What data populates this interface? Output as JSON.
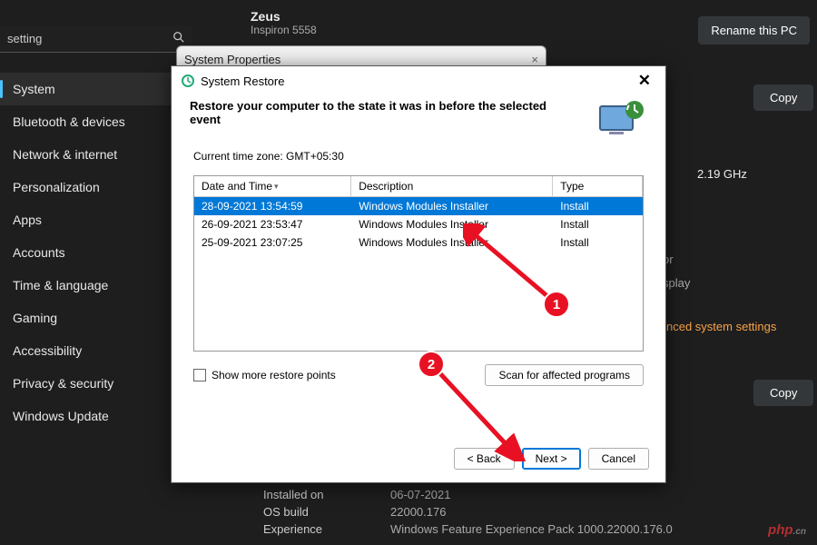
{
  "search": {
    "value": "setting",
    "icon_name": "search-icon"
  },
  "user": {
    "name": "Zeus",
    "model": "Inspiron 5558"
  },
  "rename_label": "Rename this PC",
  "sidebar": {
    "items": [
      {
        "label": "System",
        "active": true
      },
      {
        "label": "Bluetooth & devices"
      },
      {
        "label": "Network & internet"
      },
      {
        "label": "Personalization"
      },
      {
        "label": "Apps"
      },
      {
        "label": "Accounts"
      },
      {
        "label": "Time & language"
      },
      {
        "label": "Gaming"
      },
      {
        "label": "Accessibility"
      },
      {
        "label": "Privacy & security"
      },
      {
        "label": "Windows Update"
      }
    ]
  },
  "right": {
    "copy": "Copy",
    "ghz": "2.19 GHz",
    "or": "or",
    "splay": "splay",
    "advanced": "nced system settings"
  },
  "bottom": {
    "rows": [
      {
        "label": "Installed on",
        "value": "06-07-2021"
      },
      {
        "label": "OS build",
        "value": "22000.176"
      },
      {
        "label": "Experience",
        "value": "Windows Feature Experience Pack 1000.22000.176.0"
      }
    ]
  },
  "watermark": "php cn",
  "sysprop": {
    "title": "System Properties",
    "close": "×"
  },
  "dialog": {
    "title": "System Restore",
    "header": "Restore your computer to the state it was in before the selected event",
    "timezone": "Current time zone: GMT+05:30",
    "columns": [
      "Date and Time",
      "Description",
      "Type"
    ],
    "rows": [
      {
        "dt": "28-09-2021 13:54:59",
        "desc": "Windows Modules Installer",
        "type": "Install",
        "selected": true
      },
      {
        "dt": "26-09-2021 23:53:47",
        "desc": "Windows Modules Installer",
        "type": "Install"
      },
      {
        "dt": "25-09-2021 23:07:25",
        "desc": "Windows Modules Installer",
        "type": "Install"
      }
    ],
    "show_more": "Show more restore points",
    "scan": "Scan for affected programs",
    "back": "< Back",
    "next": "Next >",
    "cancel": "Cancel",
    "close": "✕"
  },
  "annotations": {
    "m1": "1",
    "m2": "2"
  }
}
